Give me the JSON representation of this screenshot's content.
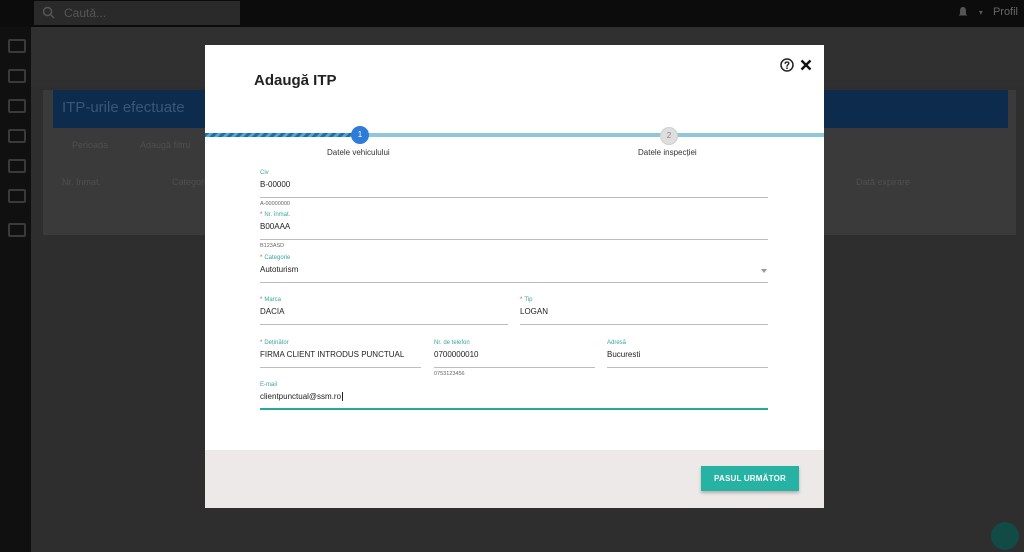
{
  "background": {
    "search_placeholder": "Caută...",
    "profile_label": "Profil",
    "panel_title": "ITP-urile efectuate",
    "filter_period": "Perioada",
    "filter_add": "Adaugă filtru",
    "col_nr_inmat": "Nr. înmat.",
    "col_categorie": "Categorie",
    "col_data_expirare": "Dată expirare"
  },
  "modal": {
    "title": "Adaugă ITP",
    "help_icon": "help-circle-icon",
    "close_icon": "close-icon",
    "steps": [
      {
        "number": "1",
        "label": "Datele vehiculului",
        "state": "active"
      },
      {
        "number": "2",
        "label": "Datele inspecției",
        "state": "pending"
      }
    ],
    "fields": {
      "civ": {
        "label": "Civ",
        "value": "B-00000",
        "hint": "A-00000000"
      },
      "nr_inmat": {
        "label": "Nr. înmat.",
        "required": true,
        "value": "B00AAA",
        "hint": "B123ASD"
      },
      "categorie": {
        "label": "Categorie",
        "required": true,
        "value": "Autoturism"
      },
      "marca": {
        "label": "Marca",
        "required": true,
        "value": "DACIA"
      },
      "tip": {
        "label": "Tip",
        "required": true,
        "value": "LOGAN"
      },
      "detinator": {
        "label": "Deținător",
        "required": true,
        "value": "FIRMA CLIENT INTRODUS PUNCTUAL"
      },
      "telefon": {
        "label": "Nr. de telefon",
        "value": "0700000010",
        "hint": "0753123456"
      },
      "adresa": {
        "label": "Adresă",
        "value": "Bucuresti"
      },
      "email": {
        "label": "E-mail",
        "value": "clientpunctual@ssm.ro"
      }
    },
    "next_button": "PASUL URMĂTOR"
  },
  "colors": {
    "accent": "#27b3a4",
    "step_active": "#2f7bd9",
    "required": "#e04040",
    "label": "#3aa79b"
  }
}
